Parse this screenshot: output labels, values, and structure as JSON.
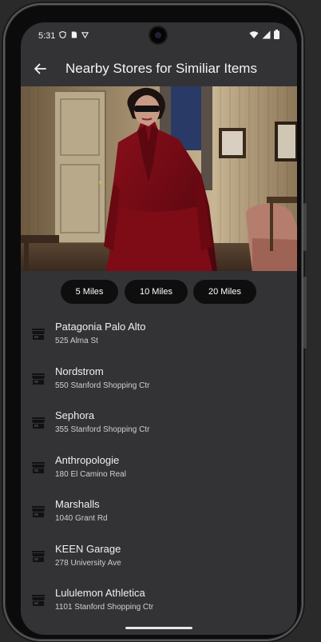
{
  "status": {
    "time": "5:31"
  },
  "app_bar": {
    "title": "Nearby Stores for Similiar Items"
  },
  "filters": [
    {
      "label": "5 Miles"
    },
    {
      "label": "10 Miles"
    },
    {
      "label": "20 Miles"
    }
  ],
  "stores": [
    {
      "name": "Patagonia Palo Alto",
      "address": "525 Alma St"
    },
    {
      "name": "Nordstrom",
      "address": "550 Stanford Shopping Ctr"
    },
    {
      "name": "Sephora",
      "address": "355 Stanford Shopping Ctr"
    },
    {
      "name": "Anthropologie",
      "address": "180 El Camino Real"
    },
    {
      "name": "Marshalls",
      "address": "1040 Grant Rd"
    },
    {
      "name": "KEEN Garage",
      "address": "278 University Ave"
    },
    {
      "name": "Lululemon Athletica",
      "address": "1101 Stanford Shopping Ctr"
    }
  ],
  "colors": {
    "screen_bg": "#333336",
    "chip_bg": "#0e0e0f",
    "text": "#f0f0f0"
  },
  "icons": {
    "back": "arrow-back-icon",
    "store": "store-icon",
    "wifi": "wifi-icon",
    "signal": "signal-icon",
    "battery": "battery-icon"
  }
}
